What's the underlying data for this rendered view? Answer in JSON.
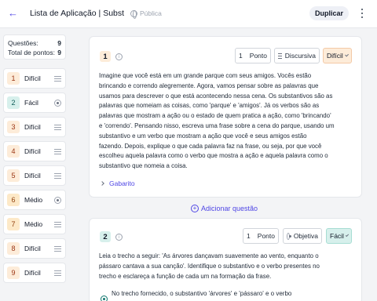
{
  "header": {
    "title": "Lista de Aplicação | Substa…",
    "visibility": "Pública",
    "duplicate_label": "Duplicar"
  },
  "summary": {
    "questions_label": "Questões:",
    "questions_value": "9",
    "points_label": "Total de pontos:",
    "points_value": "9"
  },
  "sidebar": {
    "items": [
      {
        "num": "1",
        "label": "Difícil",
        "icon": "lines"
      },
      {
        "num": "2",
        "label": "Fácil",
        "icon": "radio"
      },
      {
        "num": "3",
        "label": "Difícil",
        "icon": "lines"
      },
      {
        "num": "4",
        "label": "Difícil",
        "icon": "lines"
      },
      {
        "num": "5",
        "label": "Difícil",
        "icon": "lines"
      },
      {
        "num": "6",
        "label": "Médio",
        "icon": "radio"
      },
      {
        "num": "7",
        "label": "Médio",
        "icon": "lines"
      },
      {
        "num": "8",
        "label": "Difícil",
        "icon": "lines"
      },
      {
        "num": "9",
        "label": "Difícil",
        "icon": "lines"
      }
    ]
  },
  "q1": {
    "num": "1",
    "points_value": "1",
    "points_label": "Ponto",
    "type": "Discursiva",
    "difficulty": "Difícil",
    "lines": [
      "Imagine que você está em um grande parque com seus amigos. Vocês estão",
      "brincando e correndo alegremente. Agora, vamos pensar sobre as palavras que",
      "usamos para descrever o que está acontecendo nessa cena. Os substantivos são as",
      "palavras que nomeiam as coisas, como 'parque' e 'amigos'. Já os verbos são as",
      "palavras que mostram a ação ou o estado de quem pratica a ação, como 'brincando'",
      "e 'correndo'. Pensando nisso, escreva uma frase sobre a cena do parque, usando um",
      "substantivo e um verbo que mostram a ação que você e seus amigos estão",
      "fazendo. Depois, explique o que cada palavra faz na frase, ou seja, por que você",
      "escolheu aquela palavra como o verbo que mostra a ação e aquela palavra como o",
      "substantivo que nomeia a coisa."
    ],
    "answer_label": "Gabarito"
  },
  "add_question_label": "Adicionar questão",
  "q2": {
    "num": "2",
    "points_value": "1",
    "points_label": "Ponto",
    "type": "Objetiva",
    "difficulty": "Fácil",
    "lines": [
      "Leia o trecho a seguir: 'As árvores dançavam suavemente ao vento, enquanto o",
      "pássaro cantava a sua canção'. Identifique o substantivo e o verbo presentes no",
      "trecho e esclareça a função de cada um na formação da frase."
    ],
    "option_text": "No trecho fornecido, o substantivo 'árvores' e 'pássaro' e o verbo"
  }
}
